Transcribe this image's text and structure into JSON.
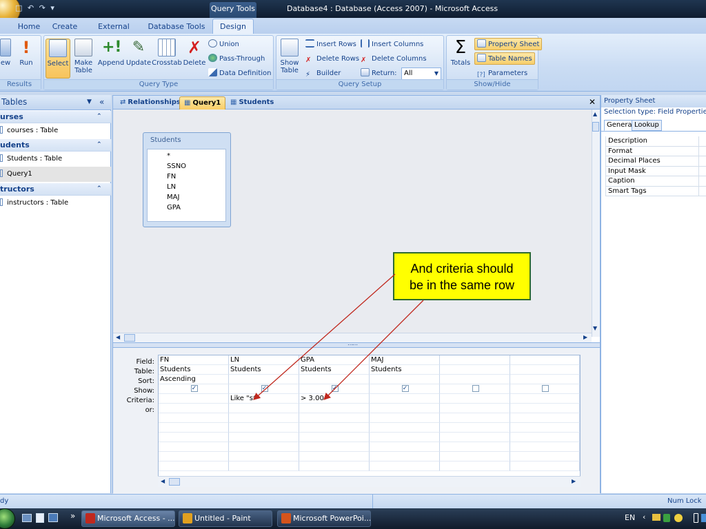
{
  "window": {
    "contextual_tab_group": "Query Tools",
    "title": "Database4 : Database (Access 2007) - Microsoft Access"
  },
  "ribbon_tabs": [
    "Home",
    "Create",
    "External Data",
    "Database Tools",
    "Design"
  ],
  "ribbon": {
    "results": {
      "label": "Results",
      "view": "ew",
      "run": "Run"
    },
    "query_type": {
      "label": "Query Type",
      "select": "Select",
      "make_table": "Make Table",
      "append": "Append",
      "update": "Update",
      "crosstab": "Crosstab",
      "delete": "Delete",
      "union": "Union",
      "pass_through": "Pass-Through",
      "data_definition": "Data Definition"
    },
    "query_setup": {
      "label": "Query Setup",
      "show_table": "Show Table",
      "insert_rows": "Insert Rows",
      "delete_rows": "Delete Rows",
      "builder": "Builder",
      "insert_columns": "Insert Columns",
      "delete_columns": "Delete Columns",
      "return_label": "Return:",
      "return_value": "All"
    },
    "show_hide": {
      "label": "Show/Hide",
      "totals": "Totals",
      "property_sheet": "Property Sheet",
      "table_names": "Table Names",
      "parameters": "Parameters"
    }
  },
  "nav_pane": {
    "title": "Tables",
    "groups": [
      {
        "name": "urses",
        "items": [
          "courses : Table"
        ]
      },
      {
        "name": "udents",
        "items": [
          "Students : Table",
          "Query1"
        ]
      },
      {
        "name": "tructors",
        "items": [
          "instructors : Table"
        ]
      }
    ]
  },
  "document_tabs": [
    "Relationships",
    "Query1",
    "Students"
  ],
  "table_box": {
    "title": "Students",
    "fields": [
      "*",
      "SSNO",
      "FN",
      "LN",
      "MAJ",
      "GPA"
    ]
  },
  "design_grid": {
    "row_labels": [
      "Field:",
      "Table:",
      "Sort:",
      "Show:",
      "Criteria:",
      "or:"
    ],
    "columns": [
      {
        "field": "FN",
        "table": "Students",
        "sort": "Ascending",
        "show": true,
        "criteria": ""
      },
      {
        "field": "LN",
        "table": "Students",
        "sort": "",
        "show": true,
        "criteria": "Like \"s*\""
      },
      {
        "field": "GPA",
        "table": "Students",
        "sort": "",
        "show": true,
        "criteria": "> 3.00"
      },
      {
        "field": "MAJ",
        "table": "Students",
        "sort": "",
        "show": true,
        "criteria": ""
      },
      {
        "field": "",
        "table": "",
        "sort": "",
        "show": false,
        "criteria": ""
      },
      {
        "field": "",
        "table": "",
        "sort": "",
        "show": false,
        "criteria": ""
      }
    ]
  },
  "property_sheet": {
    "title": "Property Sheet",
    "selection_type": "Selection type:  Field Properties",
    "tabs": [
      "General",
      "Lookup"
    ],
    "properties": [
      "Description",
      "Format",
      "Decimal Places",
      "Input Mask",
      "Caption",
      "Smart Tags"
    ]
  },
  "callout": {
    "line1": "And criteria should",
    "line2": "be in the same row",
    "color": "#ffff00"
  },
  "status_bar": {
    "left": "dy",
    "right": "Num Lock"
  },
  "taskbar": {
    "buttons": [
      "Microsoft Access - ...",
      "Untitled - Paint",
      "Microsoft PowerPoi..."
    ],
    "language": "EN",
    "chevron": "»"
  }
}
